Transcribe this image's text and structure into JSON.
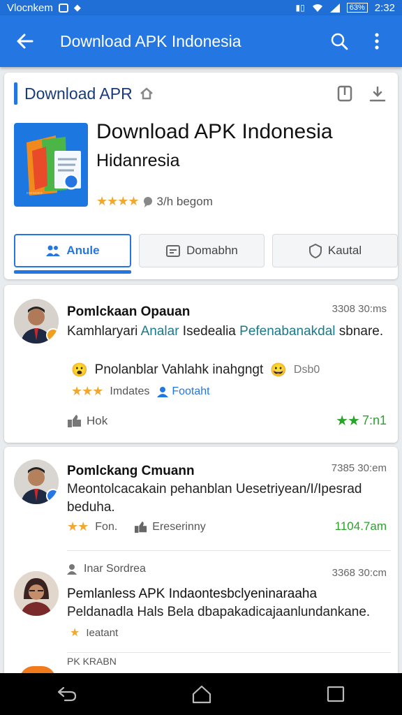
{
  "status_bar": {
    "carrier": "Vlocnkem",
    "time": "2:32",
    "battery_label": "63%"
  },
  "app_bar": {
    "title": "Download APK Indonesia"
  },
  "app_card": {
    "header_label": "Download APR",
    "name": "Download APK Indonesia",
    "subtitle": "Hidanresia",
    "rating_text": "3/h begom",
    "rating_stars": 3.5,
    "buttons": {
      "primary": "Anule",
      "second": "Domabhn",
      "third": "Kautal"
    }
  },
  "reviews": [
    {
      "name": "Pomlckaan Opauan",
      "time": "3308 30:ms",
      "text_start": "Kamhlaryari ",
      "text_hl1": "Analar",
      "text_mid": " Isedealia ",
      "text_hl2": "Pefenabanakdal",
      "text_end": " sbnare.",
      "line2": "Pnolanblar Vahlahk inahgngt",
      "line2_tag": "Dsb0",
      "stars": 2.5,
      "meta_label": "Imdates",
      "link_label": "Footaht",
      "footer_left": "Hok",
      "footer_right": "7:n1",
      "avatar_badge_color": "#f0a020"
    },
    {
      "name": "Pomlckang Cmuann",
      "time": "7385 30:em",
      "text": "Meontolcacakain pehanblan Uesetriyean/I/Ipesrad beduha.",
      "stars": 2,
      "meta_label": "Fon.",
      "link_label": "Ereserinny",
      "footer_right": "1104.7am",
      "avatar_badge_color": "#2476e3"
    },
    {
      "overline": "Inar Sordrea",
      "name": "Pemlanless APK Indaontesbclyeninaraaha",
      "time": "3368 30:cm",
      "text": "Peldanadla Hals Bela dbapakadicajaanlundankane.",
      "meta_label": "Ieatant",
      "stars": 1
    }
  ],
  "peek_label": "PK KRABN",
  "colors": {
    "primary": "#2476e3",
    "star": "#f0a830",
    "green": "#2aa32a"
  }
}
